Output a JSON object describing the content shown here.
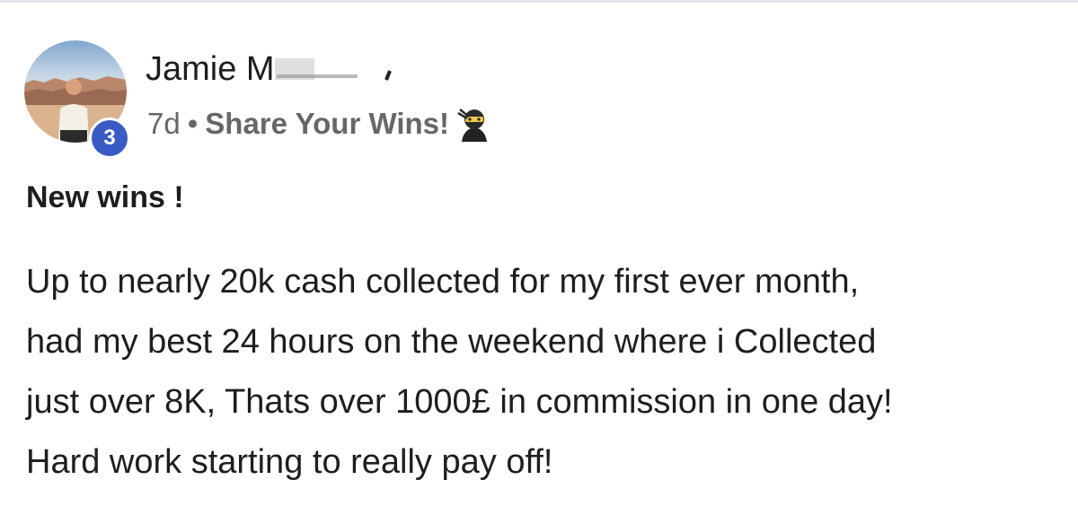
{
  "post": {
    "author": {
      "name": "Jamie M",
      "level_badge": "3"
    },
    "meta": {
      "time": "7d",
      "separator": "•",
      "category": "Share Your Wins!",
      "category_icon": "ninja-icon"
    },
    "title": "New wins !",
    "body_lines": [
      "Up to nearly 20k cash collected for my first ever month,",
      "had my best 24 hours on the weekend where i Collected",
      "just over 8K, Thats over 1000£ in commission in one day!",
      "Hard work starting to really pay off!"
    ]
  },
  "colors": {
    "badge": "#3b5bc4",
    "text_primary": "#1c1e21",
    "text_secondary": "#65676b",
    "divider": "#e4e6eb"
  }
}
